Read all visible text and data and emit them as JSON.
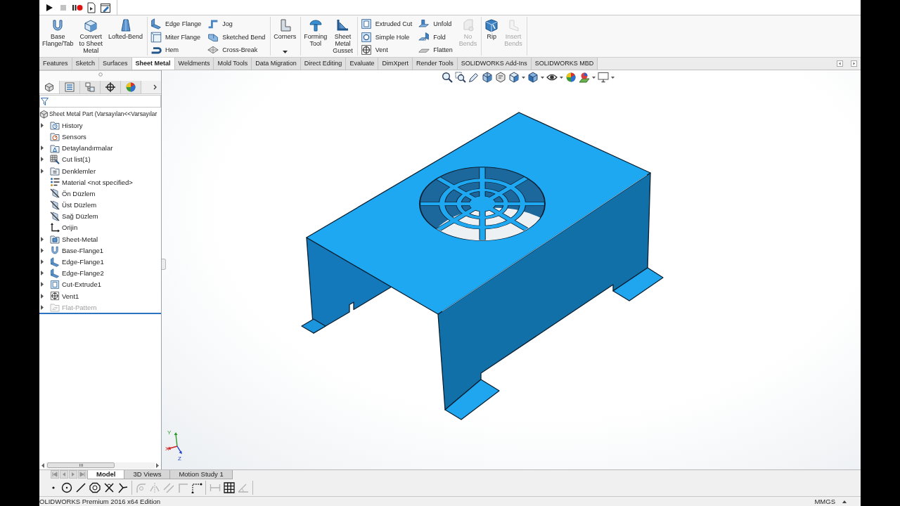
{
  "macro_toolbar": [
    {
      "disabled": false
    },
    {
      "disabled": true
    },
    {
      "disabled": false
    },
    {
      "disabled": false
    },
    {
      "disabled": false
    }
  ],
  "command_manager": {
    "groups": [
      {
        "items": [
          {
            "kind": "large",
            "label": "Base\nFlange/Tab",
            "disabled": false,
            "dropdown": false
          },
          {
            "kind": "large",
            "label": "Convert\nto Sheet\nMetal",
            "disabled": false,
            "dropdown": false
          },
          {
            "kind": "large",
            "label": "Lofted-Bend",
            "disabled": false,
            "dropdown": false
          }
        ]
      },
      {
        "items": [
          {
            "kind": "column",
            "buttons": [
              {
                "label": "Edge Flange",
                "disabled": false
              },
              {
                "label": "Miter Flange",
                "disabled": false
              },
              {
                "label": "Hem",
                "disabled": false
              }
            ]
          },
          {
            "kind": "column",
            "buttons": [
              {
                "label": "Jog",
                "disabled": false
              },
              {
                "label": "Sketched Bend",
                "disabled": false
              },
              {
                "label": "Cross-Break",
                "disabled": false
              }
            ]
          }
        ]
      },
      {
        "items": [
          {
            "kind": "large",
            "label": "Corners",
            "disabled": false,
            "dropdown": true
          }
        ]
      },
      {
        "items": [
          {
            "kind": "large",
            "label": "Forming\nTool",
            "disabled": false,
            "dropdown": false
          },
          {
            "kind": "large",
            "label": "Sheet\nMetal\nGusset",
            "disabled": false,
            "dropdown": false
          }
        ]
      },
      {
        "items": [
          {
            "kind": "column",
            "buttons": [
              {
                "label": "Extruded Cut",
                "disabled": false
              },
              {
                "label": "Simple Hole",
                "disabled": false
              },
              {
                "label": "Vent",
                "disabled": false
              }
            ]
          },
          {
            "kind": "column",
            "buttons": [
              {
                "label": "Unfold",
                "disabled": false
              },
              {
                "label": "Fold",
                "disabled": false
              },
              {
                "label": "Flatten",
                "disabled": false
              }
            ]
          },
          {
            "kind": "large",
            "label": "No\nBends",
            "disabled": true,
            "dropdown": false
          }
        ]
      },
      {
        "items": [
          {
            "kind": "large",
            "label": "Rip",
            "disabled": false,
            "dropdown": false
          },
          {
            "kind": "large",
            "label": "Insert\nBends",
            "disabled": true,
            "dropdown": false
          }
        ]
      }
    ]
  },
  "command_tabs": [
    {
      "label": "Features",
      "selected": false
    },
    {
      "label": "Sketch",
      "selected": false
    },
    {
      "label": "Surfaces",
      "selected": false
    },
    {
      "label": "Sheet Metal",
      "selected": true
    },
    {
      "label": "Weldments",
      "selected": false
    },
    {
      "label": "Mold Tools",
      "selected": false
    },
    {
      "label": "Data Migration",
      "selected": false
    },
    {
      "label": "Direct Editing",
      "selected": false
    },
    {
      "label": "Evaluate",
      "selected": false
    },
    {
      "label": "DimXpert",
      "selected": false
    },
    {
      "label": "Render Tools",
      "selected": false
    },
    {
      "label": "SOLIDWORKS Add-Ins",
      "selected": false
    },
    {
      "label": "SOLIDWORKS MBD",
      "selected": false
    }
  ],
  "feature_manager": {
    "tabs": [
      {
        "selected": true
      },
      {
        "selected": false
      },
      {
        "selected": false
      },
      {
        "selected": false
      },
      {
        "selected": false
      }
    ],
    "tree": {
      "label": "Sheet Metal Part (Varsayılan<<Varsayılar",
      "kind": "part",
      "children": [
        {
          "label": "History",
          "kind": "history",
          "expanded": false,
          "suppressed": false
        },
        {
          "label": "Sensors",
          "kind": "sensors",
          "suppressed": false
        },
        {
          "label": "Detaylandırmalar",
          "kind": "annotations",
          "expanded": false,
          "suppressed": false
        },
        {
          "label": "Cut list(1)",
          "kind": "cutlist",
          "expanded": false,
          "suppressed": false
        },
        {
          "label": "Denklemler",
          "kind": "equations",
          "expanded": false,
          "suppressed": false
        },
        {
          "label": "Material <not specified>",
          "kind": "material",
          "suppressed": false
        },
        {
          "label": "Ön Düzlem",
          "kind": "plane",
          "suppressed": false
        },
        {
          "label": "Üst Düzlem",
          "kind": "plane",
          "suppressed": false
        },
        {
          "label": "Sağ Düzlem",
          "kind": "plane",
          "suppressed": false
        },
        {
          "label": "Orijin",
          "kind": "origin",
          "suppressed": false
        },
        {
          "label": "Sheet-Metal",
          "kind": "sheetmetal",
          "expanded": false,
          "suppressed": false
        },
        {
          "label": "Base-Flange1",
          "kind": "baseflange",
          "expanded": false,
          "suppressed": false
        },
        {
          "label": "Edge-Flange1",
          "kind": "edgeflange",
          "expanded": false,
          "suppressed": false
        },
        {
          "label": "Edge-Flange2",
          "kind": "edgeflange",
          "expanded": false,
          "suppressed": false
        },
        {
          "label": "Cut-Extrude1",
          "kind": "cutextrude",
          "expanded": false,
          "suppressed": false
        },
        {
          "label": "Vent1",
          "kind": "vent",
          "expanded": false,
          "suppressed": false
        },
        {
          "label": "Flat-Pattern",
          "kind": "flatpattern",
          "expanded": false,
          "suppressed": true
        }
      ]
    }
  },
  "view_toolbar": [
    {
      "dropdown": false
    },
    {
      "dropdown": false
    },
    {
      "dropdown": false
    },
    {
      "dropdown": false
    },
    {
      "dropdown": false
    },
    {
      "dropdown": true
    },
    {
      "dropdown": true
    },
    {
      "dropdown": true
    },
    {
      "dropdown": false
    },
    {
      "dropdown": true
    },
    {
      "dropdown": true
    }
  ],
  "triad": {
    "axes": [
      {
        "label": "Y"
      },
      {
        "label": "X"
      },
      {
        "label": "Z"
      }
    ]
  },
  "bottom_tabs": {
    "scroll_buttons": [
      {
        "disabled": true
      },
      {
        "disabled": true
      },
      {
        "disabled": true
      },
      {
        "disabled": true
      }
    ],
    "tabs": [
      {
        "label": "Model",
        "selected": true
      },
      {
        "label": "3D Views",
        "selected": false
      },
      {
        "label": "Motion Study 1",
        "selected": false
      }
    ]
  },
  "sketch_toolbar": {
    "groups": [
      [
        {
          "disabled": false
        },
        {
          "disabled": false
        },
        {
          "disabled": false
        },
        {
          "disabled": false
        },
        {
          "disabled": false
        },
        {
          "disabled": false
        }
      ],
      [
        {
          "disabled": true
        },
        {
          "disabled": true
        },
        {
          "disabled": true
        },
        {
          "disabled": true
        },
        {
          "disabled": false
        }
      ],
      [
        {
          "disabled": true
        },
        {
          "disabled": false
        },
        {
          "disabled": true
        }
      ]
    ]
  },
  "status_bar": {
    "product": "OLIDWORKS Premium 2016 x64 Edition",
    "units": "MMGS"
  }
}
